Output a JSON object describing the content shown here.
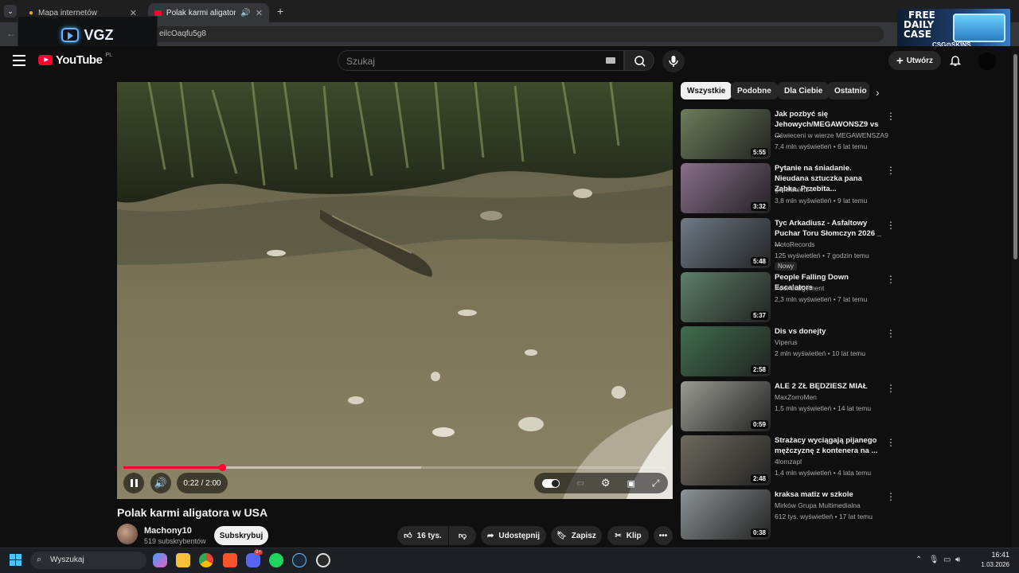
{
  "browser": {
    "tabs": [
      {
        "label": "Mapa internetów",
        "active": false
      },
      {
        "label": "Polak karmi aligatora w USA",
        "active": true
      }
    ],
    "new_tab": "+",
    "url_fragment": "eilcOaqfu5g8"
  },
  "overlay_logo": "VGZ",
  "ad": {
    "line1": "FREE",
    "line2": "DAILY",
    "line3": "CASE",
    "brand": "CSG⊙SKINS"
  },
  "youtube": {
    "logo": "YouTube",
    "region": "PL",
    "search_placeholder": "Szukaj",
    "create_label": "Utwórz"
  },
  "player": {
    "time": "0:22 / 2:00",
    "progress": 0.183,
    "buffered": 0.55
  },
  "video": {
    "title": "Polak karmi aligatora w USA",
    "channel": "Machony10",
    "subscribers": "519 subskrybentów",
    "subscribe_label": "Subskrybuj",
    "likes": "16 tys.",
    "share_label": "Udostępnij",
    "save_label": "Zapisz",
    "clip_label": "Klip"
  },
  "chips": [
    "Wszystkie",
    "Podobne",
    "Dla Ciebie",
    "Ostatnio"
  ],
  "related": [
    {
      "title": "Jak pozbyć się Jehowych/MEGAWONSZ9 vs ...",
      "channel": "Oświeceni w wierze MEGAWENSZA9",
      "meta": "7,4 mln wyświetleń • 6 lat temu",
      "duration": "5:55",
      "color": "#6d7d5a"
    },
    {
      "title": "Pytanie na śniadanie. Nieudana sztuczka pana Ząbka. Przebita...",
      "channel": "gimeldalet34",
      "meta": "3,8 mln wyświetleń • 9 lat temu",
      "duration": "3:32",
      "color": "#8a6f8c"
    },
    {
      "title": "Tyc Arkadiusz - Asfaltowy Puchar Toru Słomczyn 2026 _ ...",
      "channel": "MotoRecords",
      "meta": "125 wyświetleń • 7 godzin temu",
      "duration": "5:48",
      "color": "#6f7a86",
      "badge": "Nowy"
    },
    {
      "title": "People Falling Down Escalators",
      "channel": "Poor Judgement",
      "meta": "2,3 mln wyświetleń • 7 lat temu",
      "duration": "5:37",
      "color": "#5d7e6a"
    },
    {
      "title": "Dis vs donejty",
      "channel": "Viperus",
      "meta": "2 mln wyświetleń • 10 lat temu",
      "duration": "2:58",
      "color": "#3f6d4e"
    },
    {
      "title": "ALE 2 ZŁ BĘDZIESZ MIAŁ",
      "channel": "MaxZorroMen",
      "meta": "1,5 mln wyświetleń • 14 lat temu",
      "duration": "0:59",
      "color": "#9a9a94"
    },
    {
      "title": "Strażacy wyciągają pijanego mężczyznę z kontenera na ...",
      "channel": "4lomzapl",
      "meta": "1,4 mln wyświetleń • 4 lata temu",
      "duration": "2:48",
      "color": "#6d6a5e"
    },
    {
      "title": "kraksa matiz w szkole",
      "channel": "Mirków Grupa Multimedialna",
      "meta": "612 tys. wyświetleń • 17 lat temu",
      "duration": "0:38",
      "color": "#8d9294"
    }
  ],
  "taskbar": {
    "search_label": "Wyszukaj",
    "time": "16:41",
    "date": "1.03.2026",
    "discord_badge": "9+"
  }
}
